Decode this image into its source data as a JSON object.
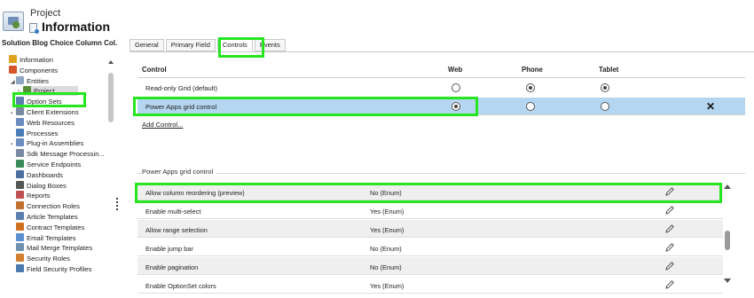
{
  "header": {
    "entity_label": "Project",
    "title": "Information"
  },
  "nav": {
    "solution_name": "Solution Blog Choice Column Col...",
    "items": [
      {
        "label": "Information",
        "icon": "info-icon",
        "color": "#e0a020",
        "indent": 0,
        "caret": ""
      },
      {
        "label": "Components",
        "icon": "components-icon",
        "color": "#d8552a",
        "indent": 0,
        "caret": ""
      },
      {
        "label": "Entities",
        "icon": "entities-icon",
        "color": "#8fa6c2",
        "indent": 1,
        "caret": "◢"
      },
      {
        "label": "Project",
        "icon": "project-icon",
        "color": "#5a8f3a",
        "indent": 2,
        "caret": "▷",
        "selected": true
      },
      {
        "label": "Option Sets",
        "icon": "option-sets-icon",
        "color": "#5b7fb0",
        "indent": 1,
        "caret": ""
      },
      {
        "label": "Client Extensions",
        "icon": "client-extensions-icon",
        "color": "#7a8aa0",
        "indent": 1,
        "caret": "▪"
      },
      {
        "label": "Web Resources",
        "icon": "web-resources-icon",
        "color": "#6a8cc0",
        "indent": 1,
        "caret": ""
      },
      {
        "label": "Processes",
        "icon": "processes-icon",
        "color": "#4a7db8",
        "indent": 1,
        "caret": ""
      },
      {
        "label": "Plug-in Assemblies",
        "icon": "plugin-assemblies-icon",
        "color": "#6a8cc0",
        "indent": 1,
        "caret": "▪"
      },
      {
        "label": "Sdk Message Processin...",
        "icon": "sdk-message-icon",
        "color": "#7a8aa0",
        "indent": 1,
        "caret": ""
      },
      {
        "label": "Service Endpoints",
        "icon": "service-endpoints-icon",
        "color": "#3a8a5a",
        "indent": 1,
        "caret": ""
      },
      {
        "label": "Dashboards",
        "icon": "dashboards-icon",
        "color": "#4a6fa0",
        "indent": 1,
        "caret": ""
      },
      {
        "label": "Dialog Boxes",
        "icon": "dialog-boxes-icon",
        "color": "#555555",
        "indent": 1,
        "caret": ""
      },
      {
        "label": "Reports",
        "icon": "reports-icon",
        "color": "#c05050",
        "indent": 1,
        "caret": ""
      },
      {
        "label": "Connection Roles",
        "icon": "connection-roles-icon",
        "color": "#c07030",
        "indent": 1,
        "caret": ""
      },
      {
        "label": "Article Templates",
        "icon": "article-templates-icon",
        "color": "#5a7fb0",
        "indent": 1,
        "caret": ""
      },
      {
        "label": "Contract Templates",
        "icon": "contract-templates-icon",
        "color": "#d07020",
        "indent": 1,
        "caret": ""
      },
      {
        "label": "Email Templates",
        "icon": "email-templates-icon",
        "color": "#5a8fd0",
        "indent": 1,
        "caret": ""
      },
      {
        "label": "Mail Merge Templates",
        "icon": "mail-merge-templates-icon",
        "color": "#7090b0",
        "indent": 1,
        "caret": ""
      },
      {
        "label": "Security Roles",
        "icon": "security-roles-icon",
        "color": "#d08030",
        "indent": 1,
        "caret": ""
      },
      {
        "label": "Field Security Profiles",
        "icon": "field-security-profiles-icon",
        "color": "#4a7ab0",
        "indent": 1,
        "caret": ""
      }
    ]
  },
  "tabs": [
    {
      "label": "General",
      "active": false
    },
    {
      "label": "Primary Field",
      "active": false
    },
    {
      "label": "Controls",
      "active": true
    },
    {
      "label": "Events",
      "active": false
    }
  ],
  "controls": {
    "headers": {
      "control": "Control",
      "web": "Web",
      "phone": "Phone",
      "tablet": "Tablet"
    },
    "rows": [
      {
        "name": "Read-only Grid (default)",
        "web": false,
        "phone": true,
        "tablet": true,
        "selected": false
      },
      {
        "name": "Power Apps grid control",
        "web": true,
        "phone": false,
        "tablet": false,
        "selected": true
      }
    ],
    "remove_symbol": "✕",
    "add_control_label": "Add Control..."
  },
  "properties": {
    "section_title": "Power Apps grid control",
    "rows": [
      {
        "name": "Allow column reordering (preview)",
        "value": "No (Enum)"
      },
      {
        "name": "Enable multi-select",
        "value": "Yes (Enum)"
      },
      {
        "name": "Allow range selection",
        "value": "Yes (Enum)"
      },
      {
        "name": "Enable jump bar",
        "value": "No (Enum)"
      },
      {
        "name": "Enable pagination",
        "value": "No (Enum)"
      },
      {
        "name": "Enable OptionSet colors",
        "value": "Yes (Enum)"
      }
    ]
  },
  "colors": {
    "highlight": "#25e61f",
    "selected_row": "#b5d6f0"
  }
}
